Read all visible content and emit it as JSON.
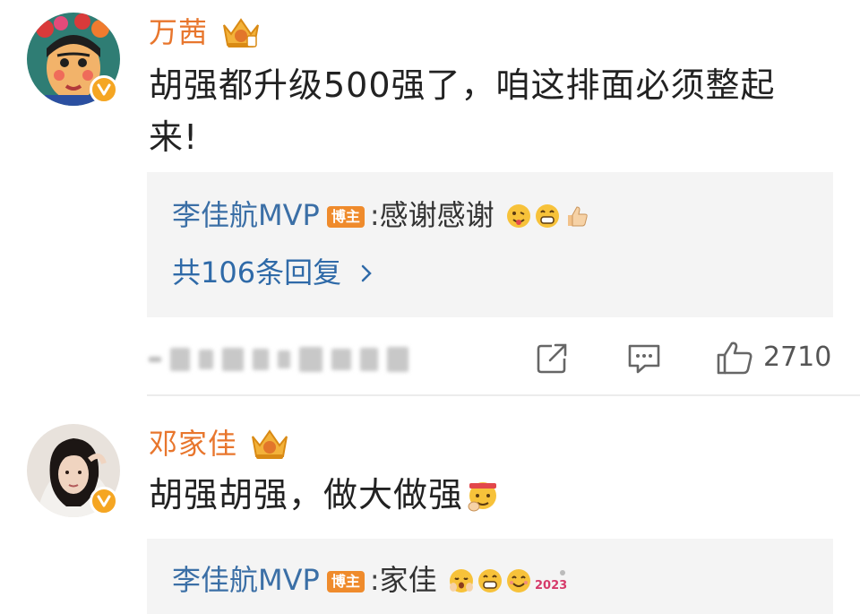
{
  "comments": [
    {
      "author": "万茜",
      "text": "胡强都升级500强了，咱这排面必须整起来!",
      "reply": {
        "author": "李佳航MVP",
        "badge": "博主",
        "separator": ":",
        "text": "感谢感谢",
        "emojis": [
          "tongue-emoji",
          "grin-emoji",
          "thumbs-up-emoji"
        ]
      },
      "more_replies": "共106条回复",
      "actions": {
        "share_icon": "share-icon",
        "comment_icon": "comment-icon",
        "like_icon": "like-icon",
        "like_count": "2710"
      }
    },
    {
      "author": "邓家佳",
      "text": "胡强胡强，做大做强",
      "text_emoji": "fist-bump-emoji",
      "reply": {
        "author": "李佳航MVP",
        "badge": "博主",
        "separator": ":",
        "text": "家佳",
        "emojis": [
          "shy-emoji",
          "grin-emoji",
          "smile-emoji",
          "2023-emoji"
        ]
      }
    }
  ],
  "colors": {
    "name": "#e8762d",
    "reply_author": "#3b6fa6",
    "bozhu_badge": "#ef8b2c",
    "reply_bg": "#f4f4f4",
    "verified": "#f5a623"
  }
}
